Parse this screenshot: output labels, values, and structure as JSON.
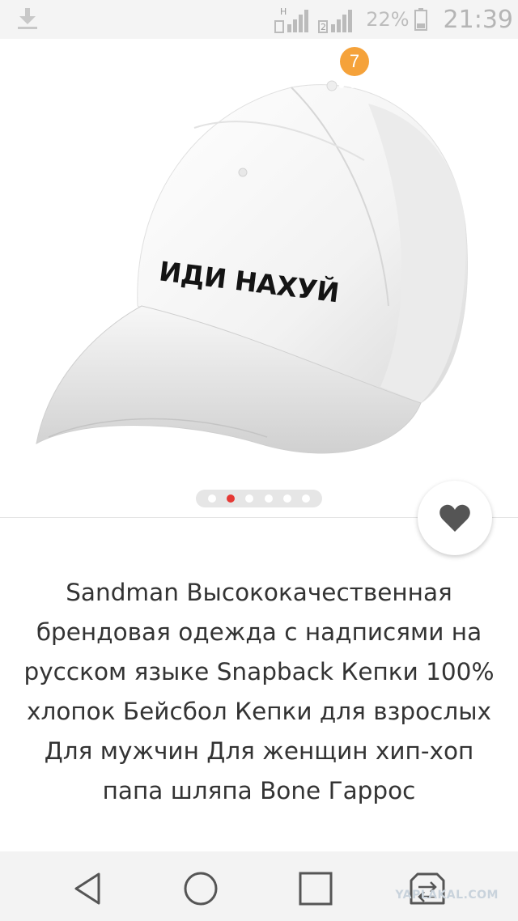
{
  "status_bar": {
    "download_icon": "download-icon",
    "sim1_label": "H",
    "sim2_label": "2",
    "battery_percent": "22%",
    "time": "21:39"
  },
  "app_bar": {
    "back_icon": "arrow-left-icon",
    "search_icon": "search-icon",
    "cart_icon": "cart-icon",
    "cart_count": "7",
    "share_icon": "share-icon",
    "more_icon": "more-vertical-icon",
    "badge_color": "#f5a23a"
  },
  "product": {
    "cap_print_text": "ИДИ НАХУЙ",
    "image_count": 6,
    "active_image_index": 1,
    "favorite_icon": "heart-icon",
    "title": "Sandman Высококачественная брендовая одежда с надписями на русском языке Snapback Кепки 100% хлопок Бейсбол Кепки для взрослых Для мужчин Для женщин хип-хоп папа шляпа Bone Гаррос"
  },
  "nav_bar": {
    "back_icon": "triangle-back-icon",
    "home_icon": "circle-home-icon",
    "recent_icon": "square-recent-icon",
    "switch_icon": "sim-switch-icon"
  },
  "watermark": "YAPLAKAL.COM"
}
